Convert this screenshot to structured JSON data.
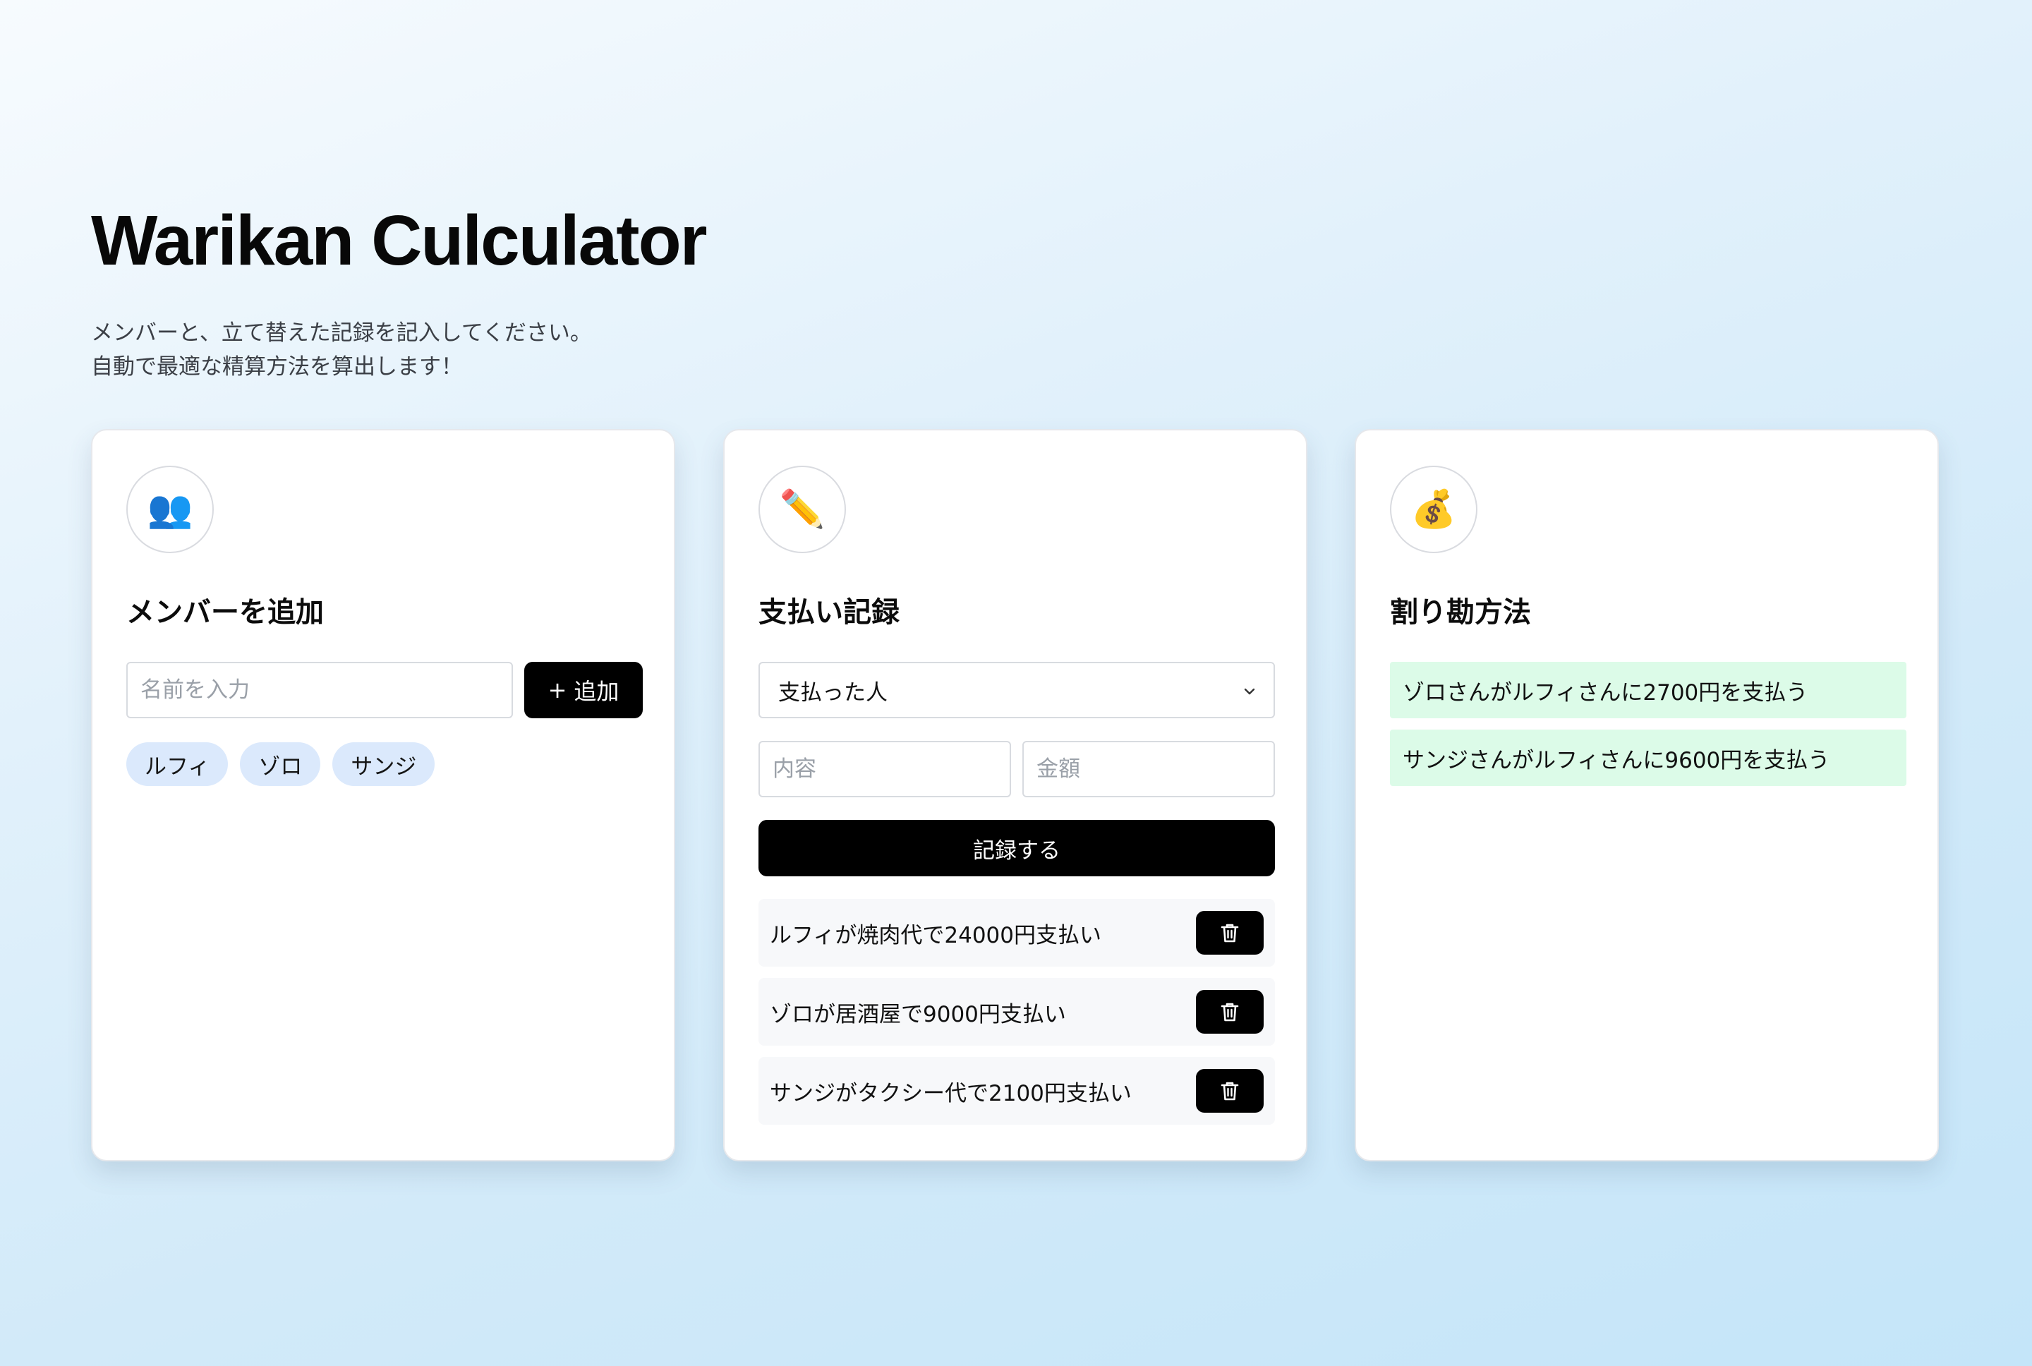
{
  "header": {
    "title": "Warikan Culculator",
    "subtitle_lines": [
      "メンバーと、立て替えた記録を記入してください。",
      "自動で最適な精算方法を算出します！"
    ]
  },
  "members_card": {
    "icon": "👥",
    "icon_name": "people-icon",
    "title": "メンバーを追加",
    "name_input": {
      "placeholder": "名前を入力",
      "value": ""
    },
    "add_button": {
      "plus": "+",
      "label": "追加"
    },
    "members": [
      "ルフィ",
      "ゾロ",
      "サンジ"
    ]
  },
  "payments_card": {
    "icon": "✏️",
    "icon_name": "pencil-icon",
    "title": "支払い記録",
    "payer_select": {
      "selected": "支払った人",
      "chevron": "⌄"
    },
    "description_input": {
      "placeholder": "内容",
      "value": ""
    },
    "amount_input": {
      "placeholder": "金額",
      "value": ""
    },
    "record_button": "記録する",
    "payments": [
      "ルフィが焼肉代で24000円支払い",
      "ゾロが居酒屋で9000円支払い",
      "サンジがタクシー代で2100円支払い"
    ]
  },
  "settlement_card": {
    "icon": "💰",
    "icon_name": "money-bag-icon",
    "title": "割り勘方法",
    "results": [
      "ゾロさんがルフィさんに2700円を支払う",
      "サンジさんがルフィさんに9600円を支払う"
    ]
  },
  "colors": {
    "primary_button": "#000000",
    "chip_background": "#dbe9fc",
    "result_background": "#dcfbe8",
    "payment_row_background": "#f7f8fa"
  }
}
